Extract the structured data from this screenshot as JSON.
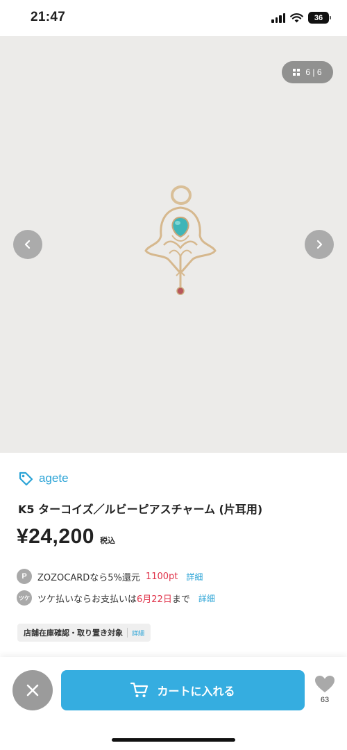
{
  "status_bar": {
    "time": "21:47",
    "battery": "36"
  },
  "gallery": {
    "counter": "6 | 6",
    "background_color": "#ecebe9"
  },
  "product": {
    "brand": "agete",
    "title": "K5 ターコイズ／ルビーピアスチャーム (片耳用)",
    "price": "¥24,200",
    "tax_label": "税込"
  },
  "benefits": {
    "points": {
      "icon_letter": "P",
      "text": "ZOZOCARDなら5%還元",
      "value": "1100pt",
      "link": "詳細"
    },
    "tsuke": {
      "icon_text": "ツケ",
      "text_before": "ツケ払いならお支払いは",
      "date": "6月22日",
      "text_after": "まで",
      "link": "詳細"
    }
  },
  "store_chip": {
    "label": "店舗在庫確認・取り置き対象",
    "link": "詳細"
  },
  "bottom_bar": {
    "cart_label": "カートに入れる",
    "favorite_count": "63"
  },
  "colors": {
    "accent": "#35ade0",
    "brand_link": "#2aa3d6",
    "highlight_red": "#e0334a",
    "close_button": "#9b9b9b"
  },
  "icons": [
    "signal-icon",
    "wifi-icon",
    "battery-icon",
    "grid-icon",
    "chevron-left-icon",
    "chevron-right-icon",
    "tag-icon",
    "close-icon",
    "cart-icon",
    "heart-icon"
  ]
}
